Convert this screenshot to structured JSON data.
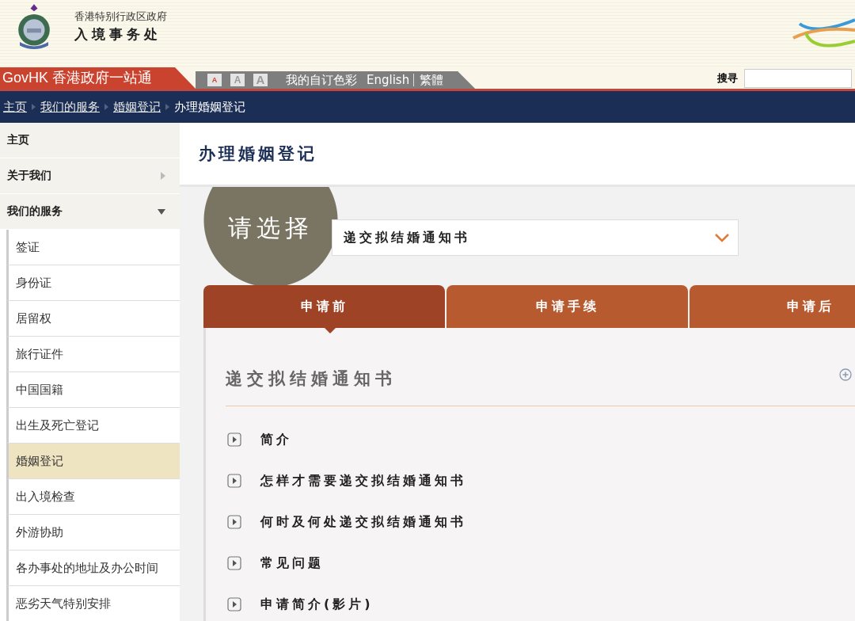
{
  "header": {
    "org_line": "香港特别行政区政府",
    "org_name": "入境事务处"
  },
  "topbar": {
    "govhk": "GovHK 香港政府一站通",
    "font_sizes": [
      "A",
      "A",
      "A"
    ],
    "links": [
      "我的自订色彩",
      "English",
      "繁體"
    ],
    "search_label": "搜寻"
  },
  "breadcrumb": [
    {
      "label": "主页",
      "link": true
    },
    {
      "label": "我们的服务",
      "link": true
    },
    {
      "label": "婚姻登记",
      "link": true
    },
    {
      "label": "办理婚姻登记",
      "link": false
    }
  ],
  "sidebar": {
    "items": [
      {
        "label": "主页",
        "selected": false
      },
      {
        "label": "关于我们",
        "selected": false,
        "expanded": false
      },
      {
        "label": "我们的服务",
        "selected": false,
        "expanded": true,
        "children": [
          {
            "label": "签证",
            "selected": false
          },
          {
            "label": "身份证",
            "selected": false
          },
          {
            "label": "居留权",
            "selected": false
          },
          {
            "label": "旅行证件",
            "selected": false
          },
          {
            "label": "中国国籍",
            "selected": false
          },
          {
            "label": "出生及死亡登记",
            "selected": false
          },
          {
            "label": "婚姻登记",
            "selected": true
          },
          {
            "label": "出入境检查",
            "selected": false
          },
          {
            "label": "外游协助",
            "selected": false
          },
          {
            "label": "各办事处的地址及办公时间",
            "selected": false
          },
          {
            "label": "恶劣天气特别安排",
            "selected": false
          }
        ]
      }
    ]
  },
  "page_title": "办理婚姻登记",
  "chooser": {
    "label": "请选择",
    "value": "递交拟结婚通知书"
  },
  "tabs": [
    {
      "label": "申请前",
      "selected": true
    },
    {
      "label": "申请手续",
      "selected": false
    },
    {
      "label": "申请后",
      "selected": false
    }
  ],
  "section": {
    "title": "递交拟结婚通知书",
    "items": [
      "简介",
      "怎样才需要递交拟结婚通知书",
      "何时及何处递交拟结婚通知书",
      "常见问题",
      "申请简介(影片)"
    ]
  }
}
